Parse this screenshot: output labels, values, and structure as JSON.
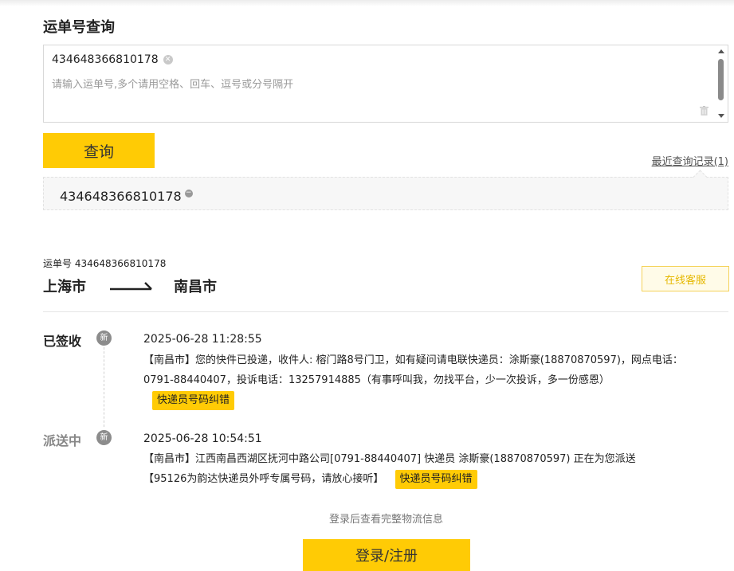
{
  "query": {
    "title": "运单号查询",
    "chip_value": "434648366810178",
    "placeholder": "请输入运单号,多个请用空格、回车、逗号或分号隔开",
    "query_button": "查询",
    "recent_link": "最近查询记录(1)",
    "history_item": "434648366810178"
  },
  "result": {
    "waybill_label": "运单号 434648366810178",
    "origin": "上海市",
    "destination": "南昌市",
    "service_button": "在线客服",
    "events": [
      {
        "status": "已签收",
        "badge": "新",
        "time": "2025-06-28 11:28:55",
        "desc": "【南昌市】您的快件已投递，收件人: 榕门路8号门卫，如有疑问请电联快递员：涂斯豪(18870870597)，网点电话：0791-88440407，投诉电话：13257914885（有事呼叫我，勿找平台，少一次投诉，多一份感恩）",
        "tag": "快递员号码纠错"
      },
      {
        "status": "派送中",
        "badge": "新",
        "time": "2025-06-28 10:54:51",
        "desc": "【南昌市】江西南昌西湖区抚河中路公司[0791-88440407] 快递员 涂斯豪(18870870597) 正在为您派送【95126为韵达快递员外呼专属号码，请放心接听】",
        "tag": "快递员号码纠错"
      }
    ],
    "login_hint": "登录后查看完整物流信息",
    "login_button": "登录/注册"
  },
  "colors": {
    "accent": "#ffcb05",
    "service_text": "#e6b800",
    "status_signed": "#222222",
    "status_delivering": "#888888"
  },
  "icons": {
    "chip_remove": "close-circle-icon",
    "trash": "trash-icon",
    "history_remove": "minus-circle-icon",
    "route_arrow": "arrow-right-icon",
    "badge": "new-badge-icon"
  }
}
